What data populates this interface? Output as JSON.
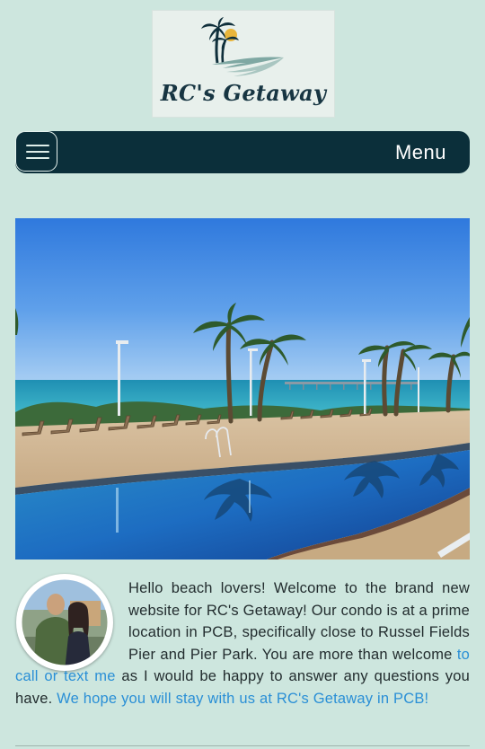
{
  "brand": {
    "name": "RC's Getaway",
    "logo_icon": "palm-tree-sun-wave-logo"
  },
  "navbar": {
    "menu_label": "Menu",
    "hamburger_icon": "hamburger-icon"
  },
  "hero": {
    "subject": "Beachfront pool with palm trees and pier"
  },
  "intro": {
    "text_before_link": "Hello beach lovers! Welcome to the brand new website for RC's Getaway! Our condo is at a prime location in PCB, specifically close to Russel Fields Pier and Pier Park. You are more than welcome ",
    "contact_link": "to call or text me",
    "text_after_link": " as I would be happy to answer any questions you have. ",
    "closing_link": "We hope you will stay with us at RC's Getaway in PCB!"
  },
  "colors": {
    "background": "#cde6de",
    "navbar": "#0b2f3a",
    "link": "#2a8fd6"
  }
}
